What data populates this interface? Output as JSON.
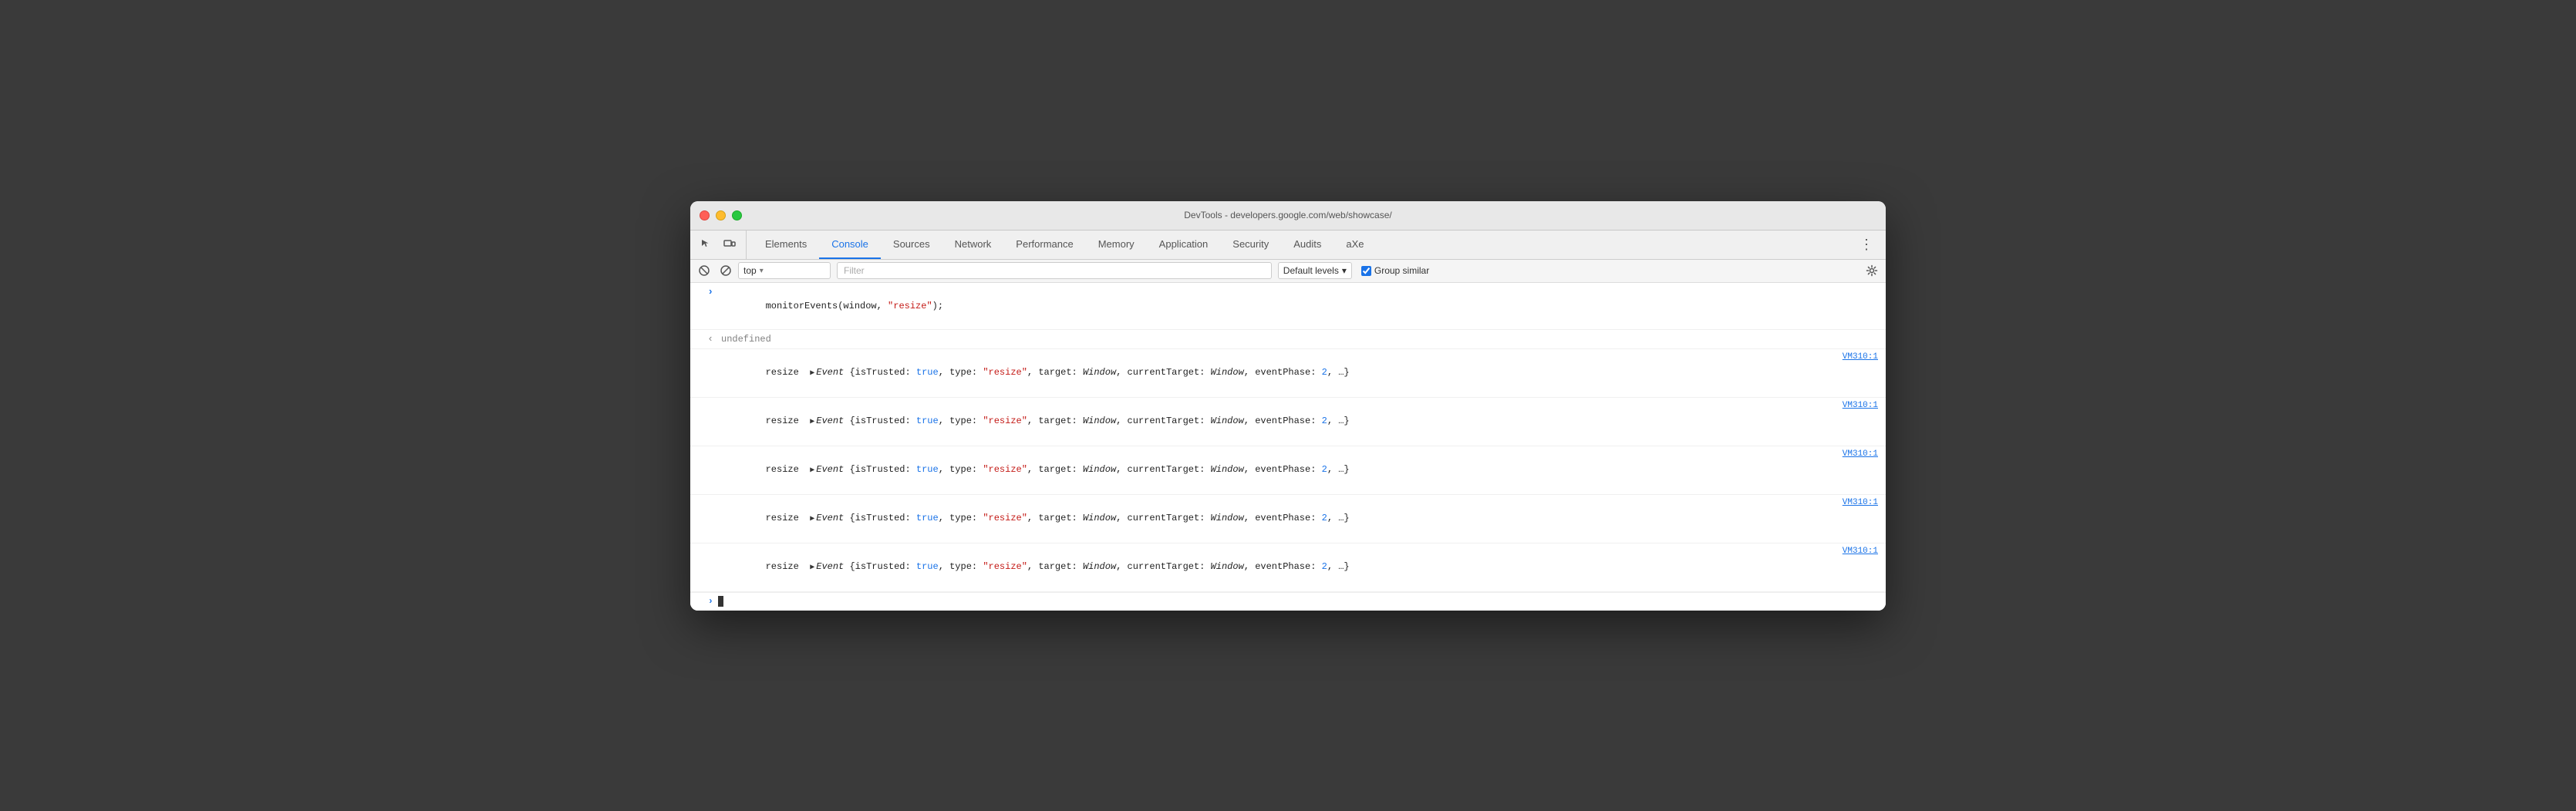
{
  "titlebar": {
    "title": "DevTools - developers.google.com/web/showcase/"
  },
  "tabs": [
    {
      "id": "elements",
      "label": "Elements",
      "active": false
    },
    {
      "id": "console",
      "label": "Console",
      "active": true
    },
    {
      "id": "sources",
      "label": "Sources",
      "active": false
    },
    {
      "id": "network",
      "label": "Network",
      "active": false
    },
    {
      "id": "performance",
      "label": "Performance",
      "active": false
    },
    {
      "id": "memory",
      "label": "Memory",
      "active": false
    },
    {
      "id": "application",
      "label": "Application",
      "active": false
    },
    {
      "id": "security",
      "label": "Security",
      "active": false
    },
    {
      "id": "audits",
      "label": "Audits",
      "active": false
    },
    {
      "id": "axe",
      "label": "aXe",
      "active": false
    }
  ],
  "toolbar": {
    "context_value": "top",
    "context_arrow": "▾",
    "filter_placeholder": "Filter",
    "levels_label": "Default levels",
    "levels_arrow": "▾",
    "group_similar_label": "Group similar",
    "group_similar_checked": true
  },
  "console_lines": [
    {
      "type": "input",
      "prompt": ">",
      "content": "monitorEvents(window, \"resize\");"
    },
    {
      "type": "output",
      "prompt": "<",
      "content": "undefined"
    },
    {
      "type": "event",
      "content": "resize  ▶Event {isTrusted: true, type: \"resize\", target: Window, currentTarget: Window, eventPhase: 2, …}",
      "source": "VM310:1"
    },
    {
      "type": "event",
      "content": "resize  ▶Event {isTrusted: true, type: \"resize\", target: Window, currentTarget: Window, eventPhase: 2, …}",
      "source": "VM310:1"
    },
    {
      "type": "event",
      "content": "resize  ▶Event {isTrusted: true, type: \"resize\", target: Window, currentTarget: Window, eventPhase: 2, …}",
      "source": "VM310:1"
    },
    {
      "type": "event",
      "content": "resize  ▶Event {isTrusted: true, type: \"resize\", target: Window, currentTarget: Window, eventPhase: 2, …}",
      "source": "VM310:1"
    },
    {
      "type": "event",
      "content": "resize  ▶Event {isTrusted: true, type: \"resize\", target: Window, currentTarget: Window, eventPhase: 2, …}",
      "source": "VM310:1"
    }
  ],
  "colors": {
    "active_tab": "#1a73e8",
    "link": "#1a73e8",
    "red": "#c41a16",
    "gray": "#808080"
  }
}
